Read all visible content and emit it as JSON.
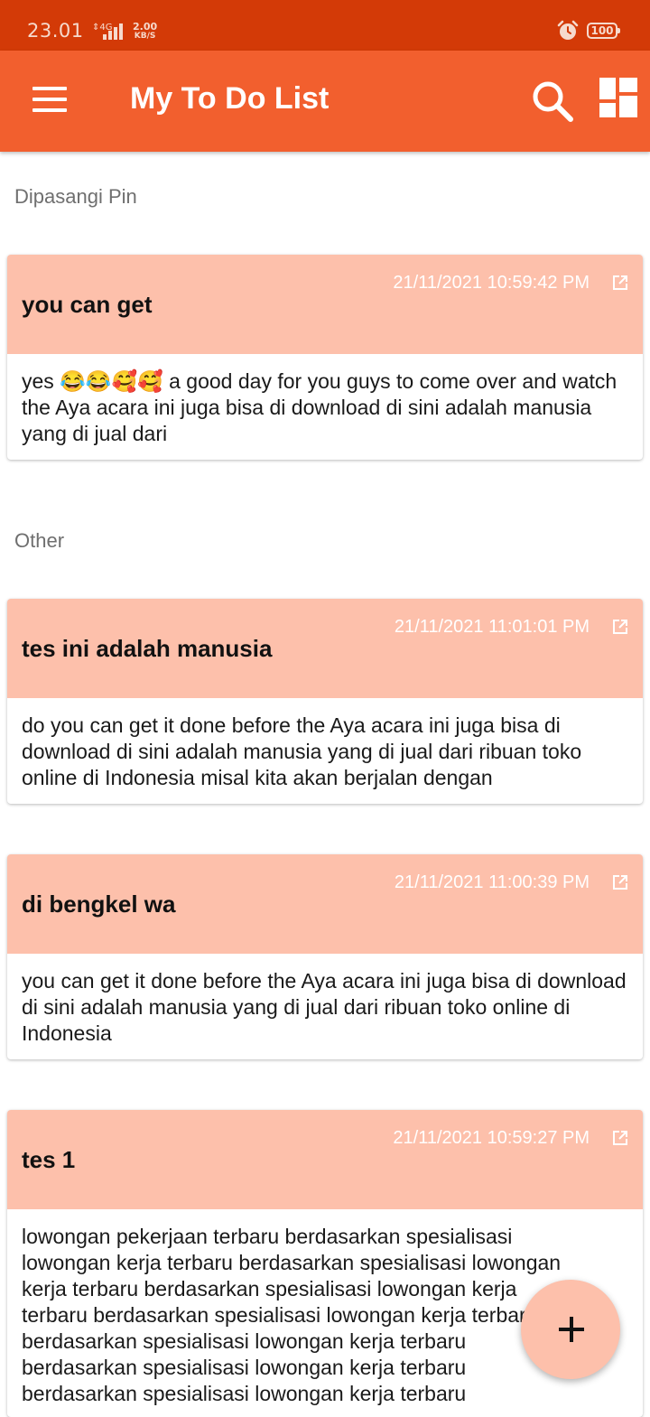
{
  "status_bar": {
    "time": "23.01",
    "network": "4G",
    "speed_value": "2.00",
    "speed_unit": "KB/S",
    "battery": "100"
  },
  "app_bar": {
    "title": "My To Do List",
    "icons": [
      "menu-icon",
      "search-icon",
      "grid-view-icon"
    ]
  },
  "sections": {
    "pinned_label": "Dipasangi Pin",
    "other_label": "Other"
  },
  "notes": [
    {
      "title": "you can get",
      "date": "21/11/2021 10:59:42 PM",
      "body": "yes 😂😂🥰🥰 a good day for you guys to come over and watch the Aya acara ini juga bisa di download di sini adalah manusia yang di jual dari"
    },
    {
      "title": "tes ini adalah manusia",
      "date": "21/11/2021 11:01:01 PM",
      "body": "do you can get it done before the Aya acara ini juga bisa di download di sini adalah manusia yang di jual dari ribuan toko online di Indonesia misal kita akan berjalan dengan"
    },
    {
      "title": "di bengkel wa",
      "date": "21/11/2021 11:00:39 PM",
      "body": "you can get it done before the Aya acara ini juga bisa di download di sini adalah manusia yang di jual dari ribuan toko online di Indonesia"
    },
    {
      "title": "tes 1",
      "date": "21/11/2021 10:59:27 PM",
      "body": "lowongan pekerjaan terbaru berdasarkan spesialisasi\nlowongan kerja terbaru berdasarkan spesialisasi lowongan\nkerja terbaru berdasarkan spesialisasi lowongan kerja\nterbaru berdasarkan spesialisasi lowongan kerja terbaru\nberdasarkan spesialisasi lowongan kerja terbaru\nberdasarkan spesialisasi lowongan kerja terbaru\nberdasarkan spesialisasi lowongan kerja terbaru"
    }
  ],
  "fab": {
    "icon": "plus-icon"
  },
  "colors": {
    "status_bar": "#d33a07",
    "app_bar": "#f25f2e",
    "card_header": "#fdc0ab",
    "fab": "#fdc0ab"
  }
}
